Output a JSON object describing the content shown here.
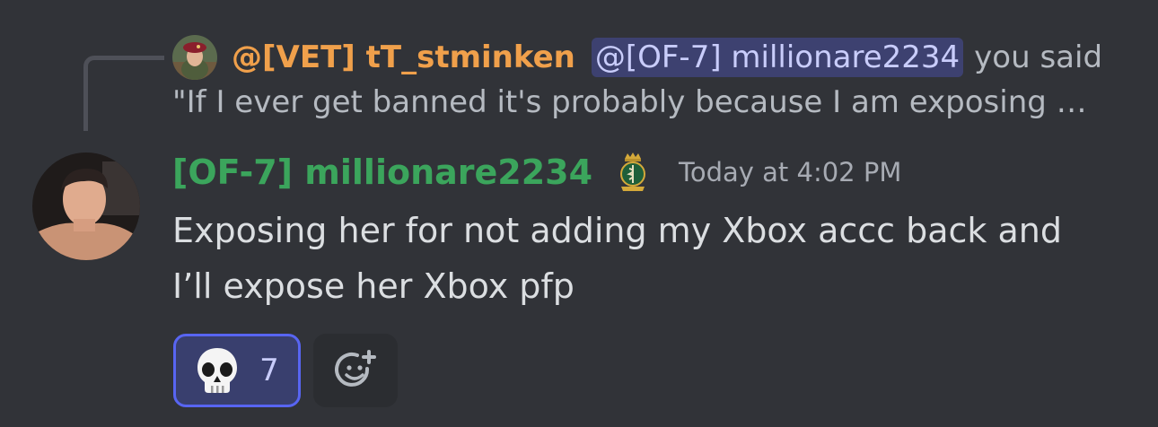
{
  "reply": {
    "author": "@[VET] tT_stminken",
    "mention": "@[OF-7] millionare2234",
    "tail": "you said",
    "excerpt": "\"If I ever get banned it's probably because I am exposing her"
  },
  "message": {
    "author": "[OF-7] millionare2234",
    "role_icon": "medical-crest-icon",
    "timestamp": "Today at 4:02 PM",
    "body_lines": [
      "Exposing her for not adding my Xbox accc back and",
      "I’ll expose her Xbox pfp"
    ]
  },
  "reactions": [
    {
      "emoji": "skull-emoji",
      "count": "7",
      "selected": true
    }
  ],
  "add_reaction_icon": "add-reaction-icon",
  "colors": {
    "background": "#313338",
    "reply_author": "#f0a04b",
    "author": "#3ba55c",
    "mention_bg": "#5865f24d",
    "accent": "#5865f2"
  }
}
